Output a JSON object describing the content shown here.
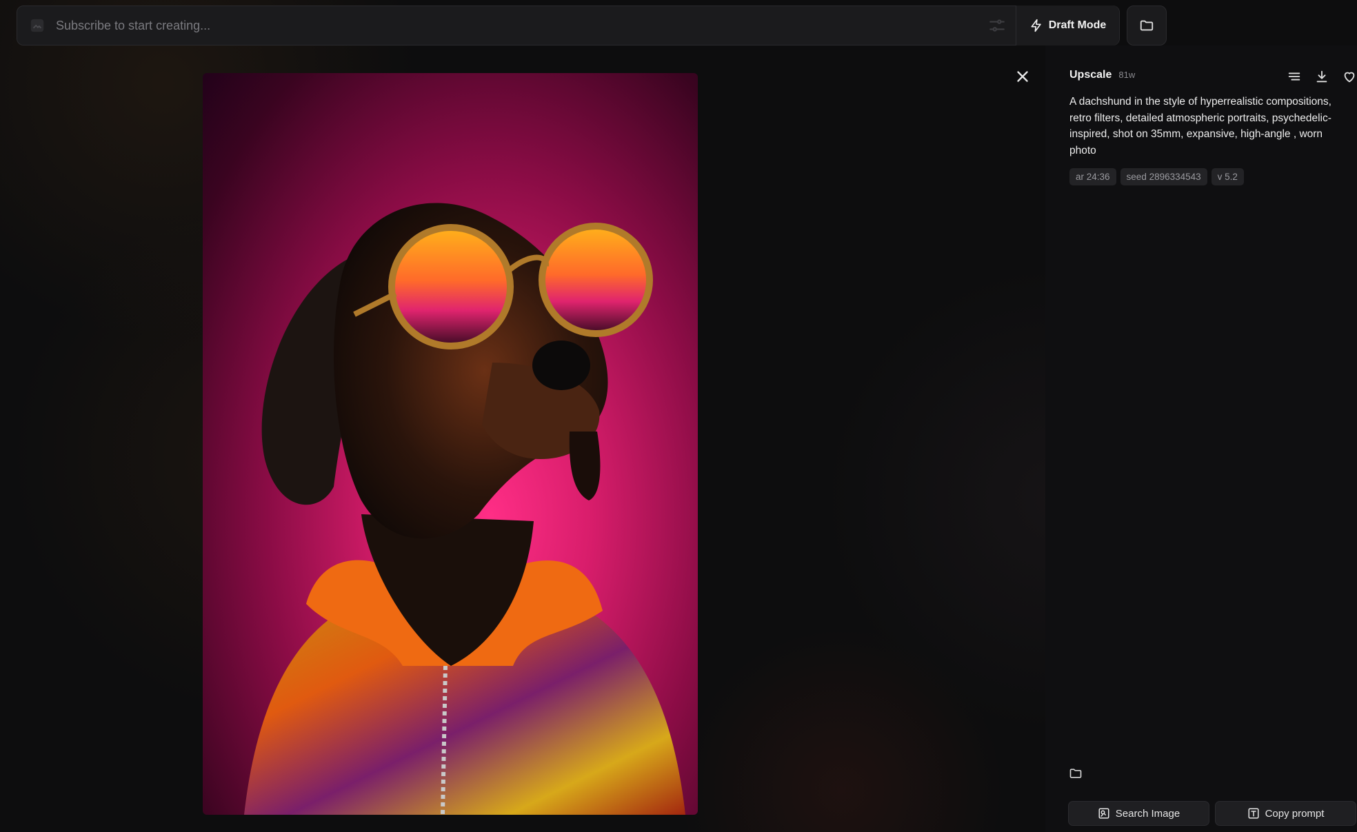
{
  "topbar": {
    "prompt_placeholder": "Subscribe to start creating...",
    "draft_label": "Draft Mode"
  },
  "panel": {
    "title": "Upscale",
    "time": "81w",
    "prompt": "A dachshund in the style of hyperrealistic compositions, retro filters, detailed atmospheric portraits, psychedelic-inspired, shot on 35mm, expansive, high-angle , worn photo",
    "tags": [
      "ar 24:36",
      "seed 2896334543",
      "v 5.2"
    ],
    "search_label": "Search Image",
    "copy_label": "Copy prompt"
  },
  "icons": {
    "draft": "lightning-icon",
    "folder": "folder-icon",
    "close": "close-icon",
    "menu": "menu-icon",
    "download": "download-icon",
    "favorite": "heart-icon",
    "search": "image-search-icon",
    "copy": "text-box-icon"
  },
  "colors": {
    "background": "#0d0d0e",
    "panel": "#0f0f11",
    "accent_pink": "#ff2e86",
    "glasses_orange": "#ff9a1a"
  }
}
